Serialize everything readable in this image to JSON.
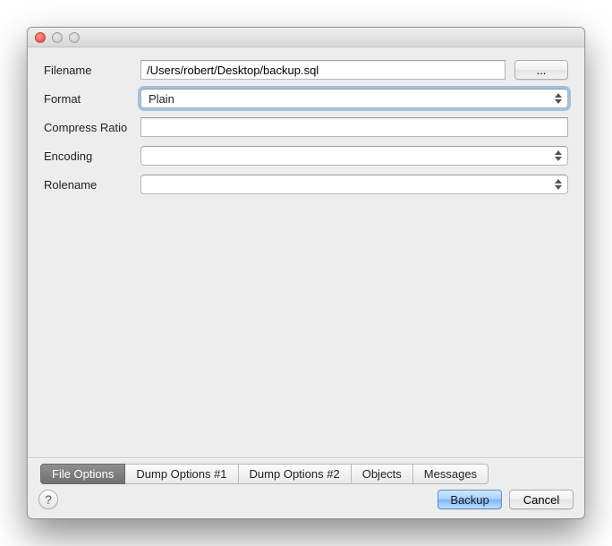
{
  "form": {
    "filename_label": "Filename",
    "filename_value": "/Users/robert/Desktop/backup.sql",
    "browse_label": "...",
    "format_label": "Format",
    "format_value": "Plain",
    "compress_label": "Compress Ratio",
    "compress_value": "",
    "encoding_label": "Encoding",
    "encoding_value": "",
    "rolename_label": "Rolename",
    "rolename_value": ""
  },
  "tabs": {
    "file_options": "File Options",
    "dump1": "Dump Options #1",
    "dump2": "Dump Options #2",
    "objects": "Objects",
    "messages": "Messages"
  },
  "buttons": {
    "help": "?",
    "backup": "Backup",
    "cancel": "Cancel"
  }
}
